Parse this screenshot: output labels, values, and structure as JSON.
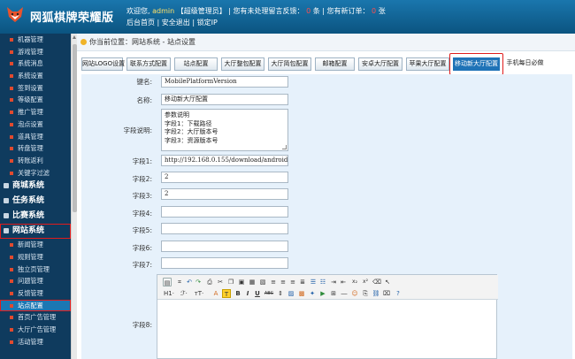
{
  "header": {
    "logo_title": "网狐棋牌荣耀版",
    "welcome_prefix": "欢迎您,",
    "username": "admin",
    "role": "【超级管理员】",
    "feedback_text": "| 您有未处理留言反馈：",
    "feedback_count": "0",
    "feedback_unit": "条",
    "order_text": "| 您有新订单：",
    "order_count": "0",
    "order_unit": "张",
    "links": [
      "后台首页",
      "安全退出",
      "锁定IP"
    ]
  },
  "sidebar": {
    "group1": [
      "机器管理",
      "游戏管理",
      "系统消息",
      "系统设置",
      "签到设置",
      "等级配置",
      "推广管理",
      "泡点设置",
      "道具管理",
      "转盘管理",
      "转账返利",
      "关键字过滤"
    ],
    "categories_mid": [
      "商城系统",
      "任务系统",
      "比赛系统"
    ],
    "web_category": "网站系统",
    "group2": [
      "新闻管理",
      "规则管理",
      "独立页管理",
      "问题管理",
      "反馈管理",
      "站点配置",
      "首页广告管理",
      "大厅广告管理",
      "活动管理"
    ],
    "active_item": "站点配置"
  },
  "breadcrumb": "你当前位置：网站系统 - 站点设置",
  "tabs": [
    "网站LOGO设置",
    "联系方式配置",
    "站点配置",
    "大厅整包配置",
    "大厅简包配置",
    "邮箱配置",
    "安卓大厅配置",
    "苹果大厅配置",
    "移动新大厅配置",
    "手机每日必做"
  ],
  "active_tab": "移动新大厅配置",
  "form": {
    "key": {
      "label": "键名:",
      "value": "MobilePlatformVersion"
    },
    "name": {
      "label": "名称:",
      "value": "移动新大厅配置"
    },
    "desc": {
      "label": "字段说明:",
      "lines": [
        "参数说明",
        "字段1：下载路径",
        "字段2：大厅版本号",
        "字段3：资源版本号"
      ]
    },
    "field1": {
      "label": "字段1:",
      "value": "http://192.168.0.155/download/android/"
    },
    "field2": {
      "label": "字段2:",
      "value": "2"
    },
    "field3": {
      "label": "字段3:",
      "value": "2"
    },
    "field4": {
      "label": "字段4:",
      "value": ""
    },
    "field5": {
      "label": "字段5:",
      "value": ""
    },
    "field6": {
      "label": "字段6:",
      "value": ""
    },
    "field7": {
      "label": "字段7:",
      "value": ""
    },
    "field8": {
      "label": "字段8:"
    }
  },
  "editor_toolbar": {
    "heading": "H1·",
    "font": "ℱ·",
    "size": "тT·",
    "bold": "B",
    "italic": "I",
    "underline": "U",
    "strike": "ABC",
    "superscript": "x²",
    "subscript": "x₂"
  }
}
